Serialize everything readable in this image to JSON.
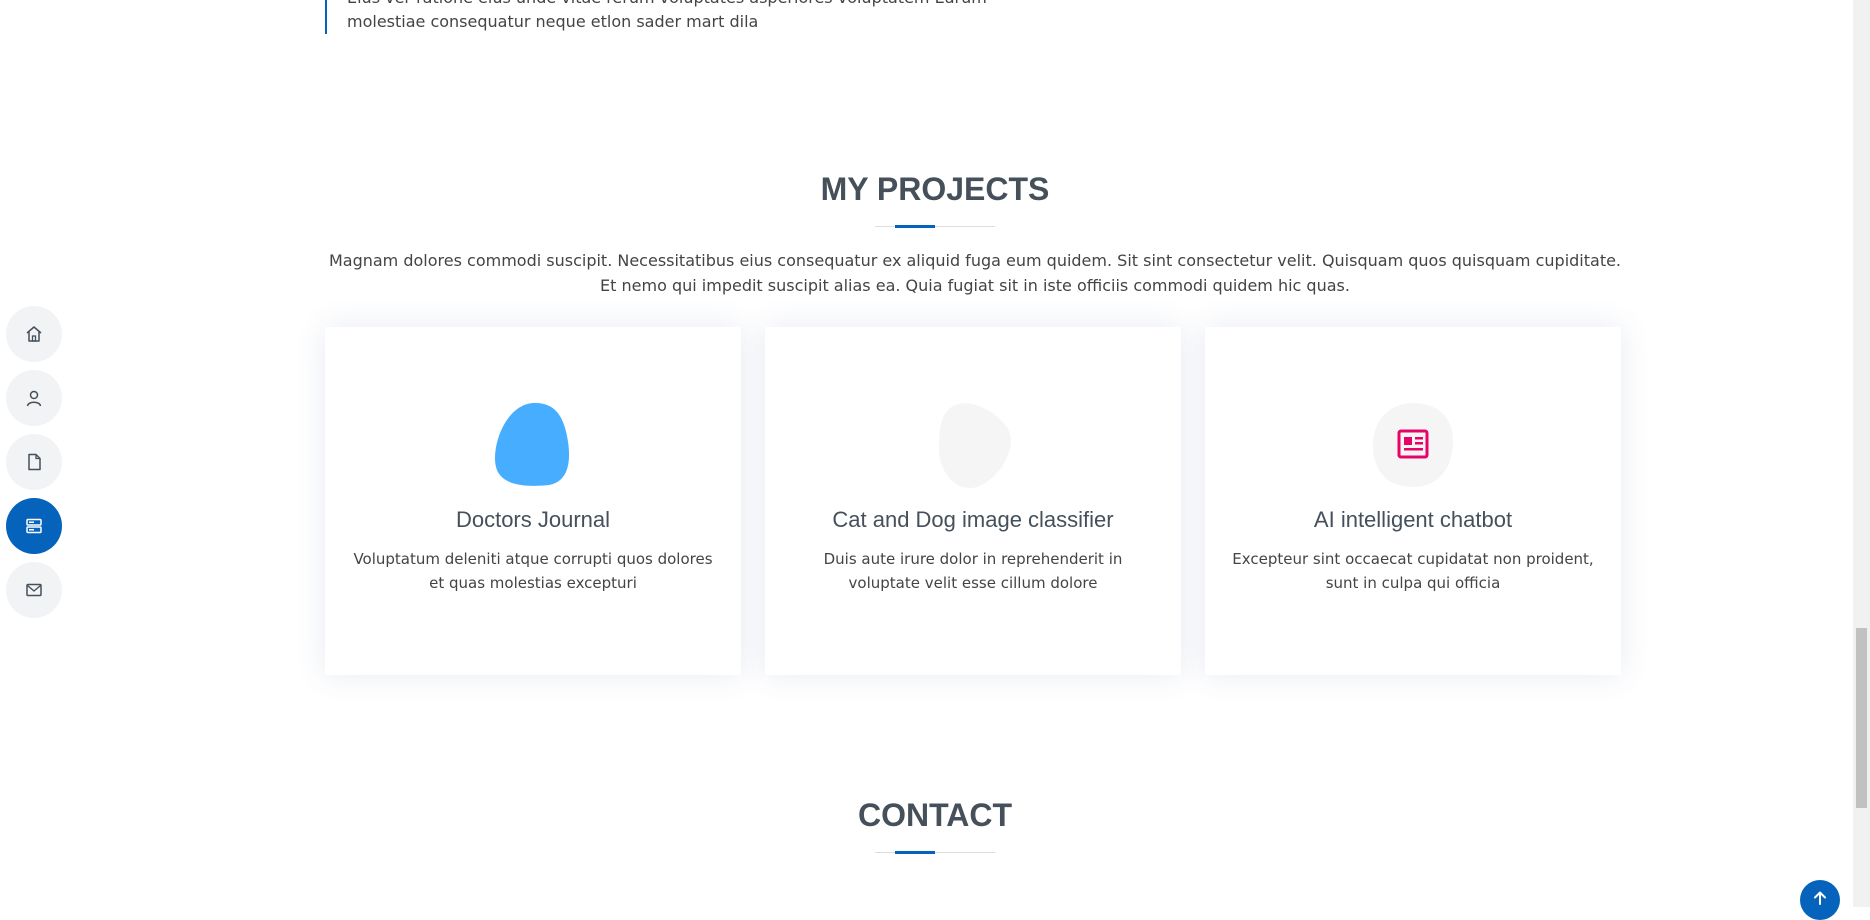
{
  "resume_quote": {
    "text_line1": "Eius ver ratione eius unde vitae rerum voluptates asperiores voluptatem Earum",
    "text_line2": "molestiae consequatur neque etlon sader mart dila"
  },
  "projects": {
    "title": "MY PROJECTS",
    "description": "Magnam dolores commodi suscipit. Necessitatibus eius consequatur ex aliquid fuga eum quidem. Sit sint consectetur velit. Quisquam quos quisquam cupiditate. Et nemo qui impedit suscipit alias ea. Quia fugiat sit in iste officiis commodi quidem hic quas.",
    "items": [
      {
        "title": "Doctors Journal",
        "text": "Voluptatum deleniti atque corrupti quos dolores et quas molestias excepturi",
        "blob_color": "#47aeff",
        "icon": "none"
      },
      {
        "title": "Cat and Dog image classifier",
        "text": "Duis aute irure dolor in reprehenderit in voluptate velit esse cillum dolore",
        "blob_color": "#f5f5f5",
        "icon": "none"
      },
      {
        "title": "AI intelligent chatbot",
        "text": "Excepteur sint occaecat cupidatat non proident, sunt in culpa qui officia",
        "blob_color": "#f5f5f5",
        "icon": "newspaper-icon",
        "icon_color": "#e80368"
      }
    ]
  },
  "contact": {
    "title": "CONTACT"
  },
  "sidenav": {
    "items": [
      {
        "name": "home",
        "icon": "home-icon",
        "active": false
      },
      {
        "name": "about",
        "icon": "person-icon",
        "active": false
      },
      {
        "name": "resume",
        "icon": "file-icon",
        "active": false
      },
      {
        "name": "projects",
        "icon": "server-icon",
        "active": true
      },
      {
        "name": "contact",
        "icon": "envelope-icon",
        "active": false
      }
    ]
  },
  "colors": {
    "accent": "#0563bb",
    "heading": "#45505b",
    "text": "#444444",
    "nav_bg": "#f2f3f5"
  }
}
